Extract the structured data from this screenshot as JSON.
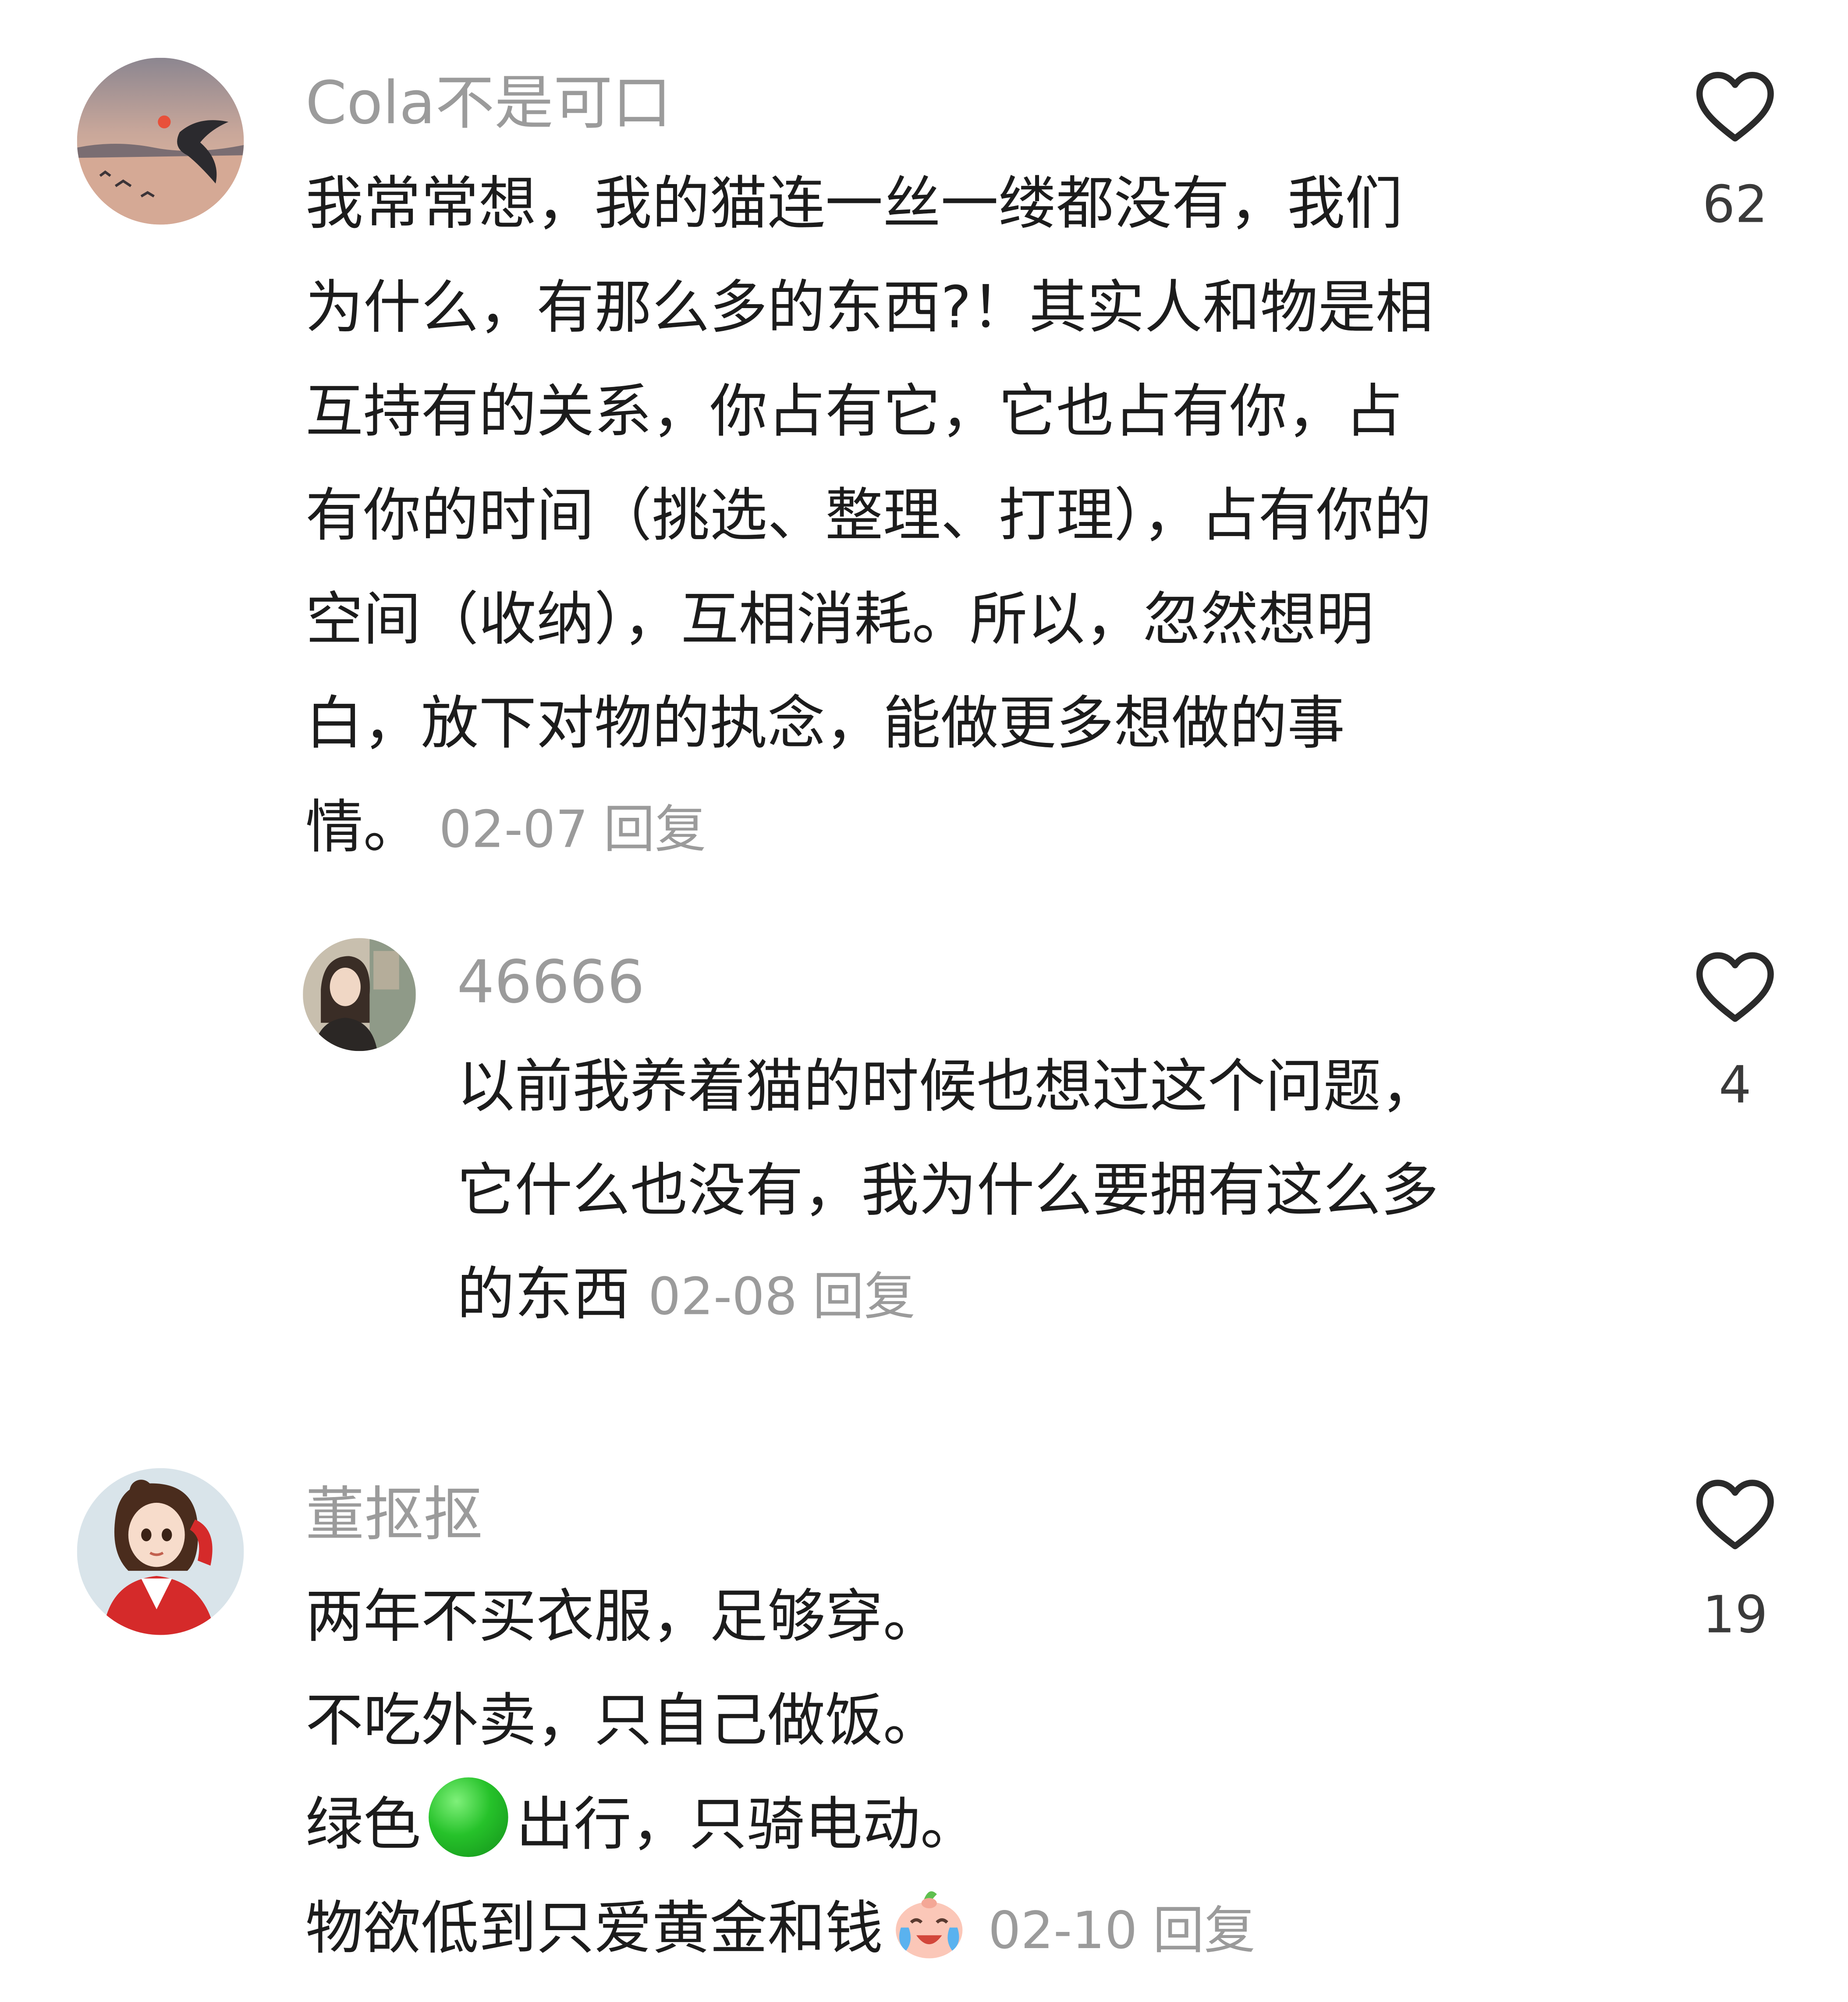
{
  "comments": [
    {
      "username": "Cola不是可口",
      "avatar_icon": "sunset-seagull-avatar",
      "lines": [
        "我常常想，我的猫连一丝一缕都没有，我们",
        "为什么，有那么多的东西?！其实人和物是相",
        "互持有的关系，你占有它，它也占有你，占",
        "有你的时间（挑选、整理、打理），占有你的",
        "空间（收纳），互相消耗。所以，忽然想明",
        "白，放下对物的执念，能做更多想做的事"
      ],
      "last_line": "情。",
      "date": "02-07",
      "reply_label": "回复",
      "likes": "62"
    },
    {
      "username": "46666",
      "avatar_icon": "woman-photo-avatar",
      "lines": [
        "以前我养着猫的时候也想过这个问题，",
        "它什么也没有，我为什么要拥有这么多"
      ],
      "last_line": "的东西",
      "date": "02-08",
      "reply_label": "回复",
      "likes": "4"
    },
    {
      "username": "董抠抠",
      "avatar_icon": "cartoon-girl-avatar",
      "lines": [
        "两年不买衣服，足够穿。",
        "不吃外卖，只自己做饭。"
      ],
      "green_line_before": "绿色",
      "green_line_after": "出行，只骑电动。",
      "last_line": "物欲低到只爱黄金和钱",
      "date": "02-10",
      "reply_label": "回复",
      "likes": "19"
    }
  ],
  "colors": {
    "text": "#1c1c1c",
    "muted": "#9b9b9b",
    "icon": "#2a2a2a"
  }
}
